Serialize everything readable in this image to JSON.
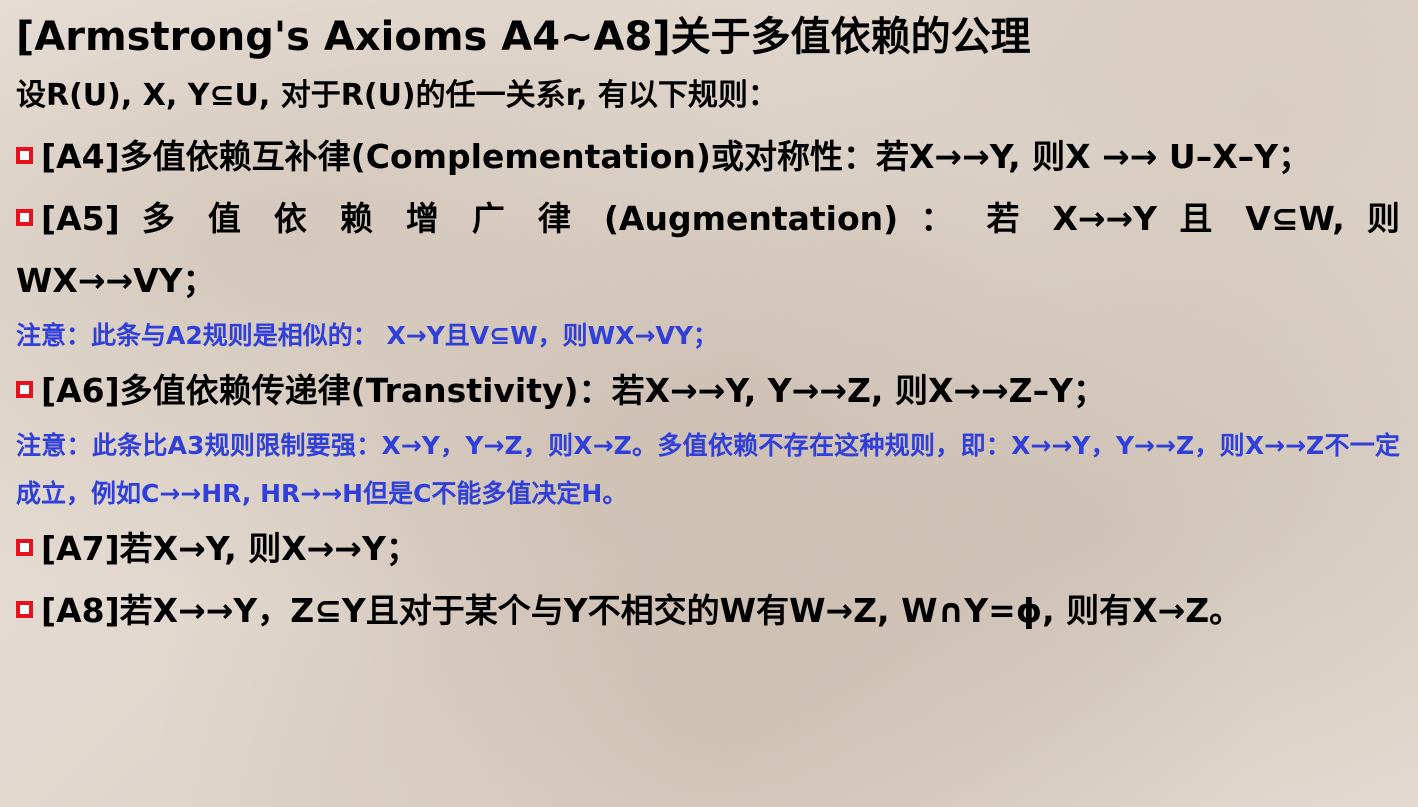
{
  "title": "[Armstrong's Axioms A4~A8]关于多值依赖的公理",
  "intro": "设R(U), X, Y⊆U, 对于R(U)的任一关系r, 有以下规则：",
  "rules": [
    {
      "text": "[A4]多值依赖互补律(Complementation)或对称性：若X→→Y, 则X →→ U–X–Y；"
    },
    {
      "line1": "[A5] 多 值 依 赖 增 广 律 (Augmentation) ： 若 X→→Y 且 V⊆W, 则",
      "line2": "WX→→VY；",
      "note": "注意：此条与A2规则是相似的： X→Y且V⊆W，则WX→VY；"
    },
    {
      "text": "[A6]多值依赖传递律(Transtivity)：若X→→Y, Y→→Z, 则X→→Z–Y；",
      "note": "注意：此条比A3规则限制要强：X→Y，Y→Z，则X→Z。多值依赖不存在这种规则，即：X→→Y，Y→→Z，则X→→Z不一定成立，例如C→→HR, HR→→H但是C不能多值决定H。"
    },
    {
      "text": "[A7]若X→Y, 则X→→Y；"
    },
    {
      "text": "[A8]若X→→Y，Z⊆Y且对于某个与Y不相交的W有W→Z, W∩Y=ϕ, 则有X→Z。"
    }
  ],
  "colors": {
    "text": "#000000",
    "note": "#2f3fd8",
    "bullet_border": "#e8101d"
  },
  "icons": {
    "bullet": "red-hollow-square-bullet"
  }
}
